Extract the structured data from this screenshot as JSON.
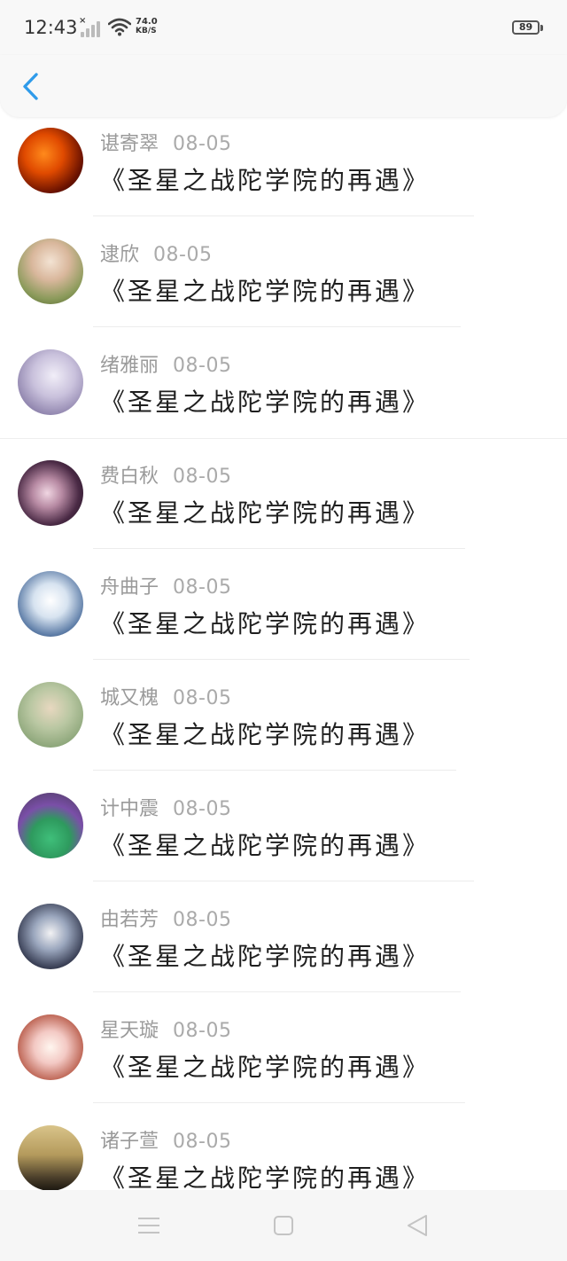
{
  "status_bar": {
    "time": "12:43",
    "speed_value": "74.0",
    "speed_unit": "KB/S",
    "battery": "89",
    "icons": [
      "signal-icon",
      "wifi-icon",
      "battery-icon"
    ]
  },
  "header": {
    "back_icon": "chevron-left-icon",
    "accent_color": "#2f9bea"
  },
  "comments": [
    {
      "name": "谌寄翠",
      "date": "08-05",
      "title": "《圣星之战陀学院的再遇》"
    },
    {
      "name": "逮欣",
      "date": "08-05",
      "title": "《圣星之战陀学院的再遇》"
    },
    {
      "name": "绪雅丽",
      "date": "08-05",
      "title": "《圣星之战陀学院的再遇》"
    },
    {
      "name": "费白秋",
      "date": "08-05",
      "title": "《圣星之战陀学院的再遇》"
    },
    {
      "name": "舟曲子",
      "date": "08-05",
      "title": "《圣星之战陀学院的再遇》"
    },
    {
      "name": "城又槐",
      "date": "08-05",
      "title": "《圣星之战陀学院的再遇》"
    },
    {
      "name": "计中震",
      "date": "08-05",
      "title": "《圣星之战陀学院的再遇》"
    },
    {
      "name": "由若芳",
      "date": "08-05",
      "title": "《圣星之战陀学院的再遇》"
    },
    {
      "name": "星天璇",
      "date": "08-05",
      "title": "《圣星之战陀学院的再遇》"
    },
    {
      "name": "诸子萱",
      "date": "08-05",
      "title": "《圣星之战陀学院的再遇》"
    }
  ],
  "nav": {
    "icons": [
      "menu-icon",
      "home-square-icon",
      "back-triangle-icon"
    ]
  }
}
